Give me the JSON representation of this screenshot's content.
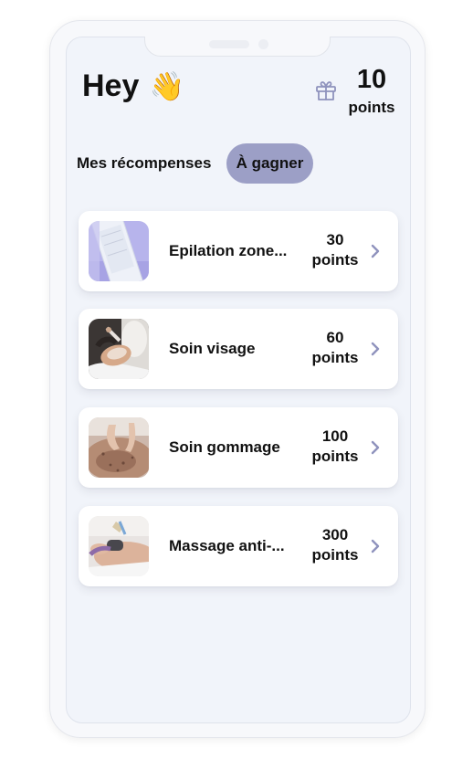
{
  "header": {
    "greeting": "Hey",
    "wave_emoji": "👋",
    "points_value": "10",
    "points_label": "points",
    "gift_icon": "gift-icon"
  },
  "tabs": [
    {
      "label": "Mes récompenses",
      "active": false
    },
    {
      "label": "À gagner",
      "active": true
    }
  ],
  "rewards": [
    {
      "title": "Epilation zone...",
      "points": "30",
      "points_label": "points",
      "thumbnail": "waxing-strip-image"
    },
    {
      "title": "Soin visage",
      "points": "60",
      "points_label": "points",
      "thumbnail": "facial-care-image"
    },
    {
      "title": "Soin gommage",
      "points": "100",
      "points_label": "points",
      "thumbnail": "body-scrub-image"
    },
    {
      "title": "Massage anti-...",
      "points": "300",
      "points_label": "points",
      "thumbnail": "massage-device-image"
    }
  ],
  "colors": {
    "active_tab_bg": "#9c9fc6",
    "screen_bg": "#f1f4fa",
    "card_bg": "#ffffff",
    "text": "#111111",
    "chevron": "#8f93bd",
    "gift_icon": "#8f93bd"
  }
}
